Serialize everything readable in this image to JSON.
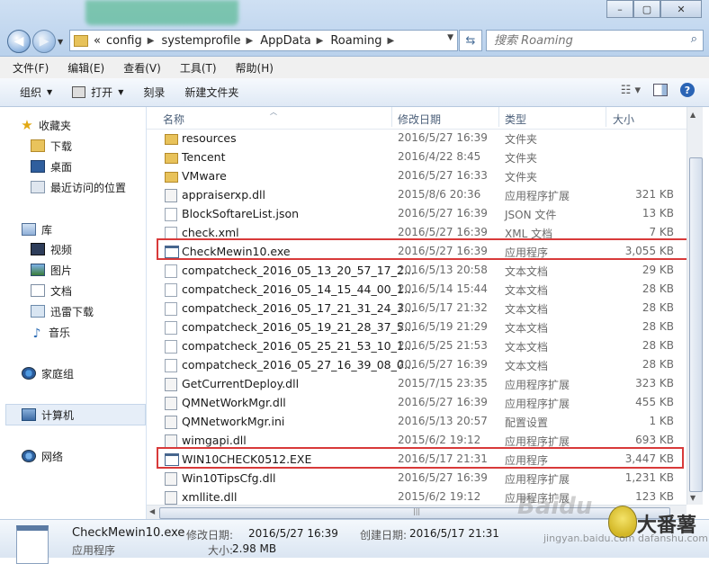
{
  "window": {
    "controls": {
      "minimize": "–",
      "maximize": "▢",
      "close": "✕"
    }
  },
  "address": {
    "prefix": "«",
    "segments": [
      "config",
      "systemprofile",
      "AppData",
      "Roaming"
    ],
    "search_placeholder": "搜索 Roaming"
  },
  "menu": [
    "文件(F)",
    "编辑(E)",
    "查看(V)",
    "工具(T)",
    "帮助(H)"
  ],
  "toolbar": {
    "organize": "组织",
    "open": "打开",
    "burn": "刻录",
    "new_folder": "新建文件夹"
  },
  "nav": {
    "favorites": "收藏夹",
    "downloads": "下载",
    "desktop": "桌面",
    "recent": "最近访问的位置",
    "libraries": "库",
    "videos": "视频",
    "pictures": "图片",
    "documents": "文档",
    "thunder": "迅雷下载",
    "music": "音乐",
    "homegroup": "家庭组",
    "computer": "计算机",
    "network": "网络"
  },
  "columns": {
    "name": "名称",
    "date": "修改日期",
    "type": "类型",
    "size": "大小"
  },
  "files": [
    {
      "name": "resources",
      "date": "2016/5/27 16:39",
      "type": "文件夹",
      "size": "",
      "kind": "folder"
    },
    {
      "name": "Tencent",
      "date": "2016/4/22 8:45",
      "type": "文件夹",
      "size": "",
      "kind": "folder"
    },
    {
      "name": "VMware",
      "date": "2016/5/27 16:33",
      "type": "文件夹",
      "size": "",
      "kind": "folder"
    },
    {
      "name": "appraiserxp.dll",
      "date": "2015/8/6 20:36",
      "type": "应用程序扩展",
      "size": "321 KB",
      "kind": "dll"
    },
    {
      "name": "BlockSoftareList.json",
      "date": "2016/5/27 16:39",
      "type": "JSON 文件",
      "size": "13 KB",
      "kind": "json"
    },
    {
      "name": "check.xml",
      "date": "2016/5/27 16:39",
      "type": "XML 文档",
      "size": "7 KB",
      "kind": "xml"
    },
    {
      "name": "CheckMewin10.exe",
      "date": "2016/5/27 16:39",
      "type": "应用程序",
      "size": "3,055 KB",
      "kind": "exe"
    },
    {
      "name": "compatcheck_2016_05_13_20_57_17_2...",
      "date": "2016/5/13 20:58",
      "type": "文本文档",
      "size": "29 KB",
      "kind": "txt"
    },
    {
      "name": "compatcheck_2016_05_14_15_44_00_1...",
      "date": "2016/5/14 15:44",
      "type": "文本文档",
      "size": "28 KB",
      "kind": "txt"
    },
    {
      "name": "compatcheck_2016_05_17_21_31_24_3...",
      "date": "2016/5/17 21:32",
      "type": "文本文档",
      "size": "28 KB",
      "kind": "txt"
    },
    {
      "name": "compatcheck_2016_05_19_21_28_37_5...",
      "date": "2016/5/19 21:29",
      "type": "文本文档",
      "size": "28 KB",
      "kind": "txt"
    },
    {
      "name": "compatcheck_2016_05_25_21_53_10_1...",
      "date": "2016/5/25 21:53",
      "type": "文本文档",
      "size": "28 KB",
      "kind": "txt"
    },
    {
      "name": "compatcheck_2016_05_27_16_39_08_0...",
      "date": "2016/5/27 16:39",
      "type": "文本文档",
      "size": "28 KB",
      "kind": "txt"
    },
    {
      "name": "GetCurrentDeploy.dll",
      "date": "2015/7/15 23:35",
      "type": "应用程序扩展",
      "size": "323 KB",
      "kind": "dll"
    },
    {
      "name": "QMNetWorkMgr.dll",
      "date": "2016/5/27 16:39",
      "type": "应用程序扩展",
      "size": "455 KB",
      "kind": "dll"
    },
    {
      "name": "QMNetworkMgr.ini",
      "date": "2016/5/13 20:57",
      "type": "配置设置",
      "size": "1 KB",
      "kind": "ini"
    },
    {
      "name": "wimgapi.dll",
      "date": "2015/6/2 19:12",
      "type": "应用程序扩展",
      "size": "693 KB",
      "kind": "dll"
    },
    {
      "name": "WIN10CHECK0512.EXE",
      "date": "2016/5/17 21:31",
      "type": "应用程序",
      "size": "3,447 KB",
      "kind": "exe"
    },
    {
      "name": "Win10TipsCfg.dll",
      "date": "2016/5/27 16:39",
      "type": "应用程序扩展",
      "size": "1,231 KB",
      "kind": "dll"
    },
    {
      "name": "xmllite.dll",
      "date": "2015/6/2 19:12",
      "type": "应用程序扩展",
      "size": "123 KB",
      "kind": "dll"
    }
  ],
  "highlight_color": "#d83a3a",
  "details": {
    "name": "CheckMewin10.exe",
    "type": "应用程序",
    "modified_label": "修改日期:",
    "modified": "2016/5/27 16:39",
    "created_label": "创建日期:",
    "created": "2016/5/17 21:31",
    "size_label": "大小:",
    "size": "2.98 MB"
  },
  "watermark": {
    "text": "Baidu",
    "brand": "大番薯",
    "url": "jingyan.baidu.com  dafanshu.com"
  }
}
